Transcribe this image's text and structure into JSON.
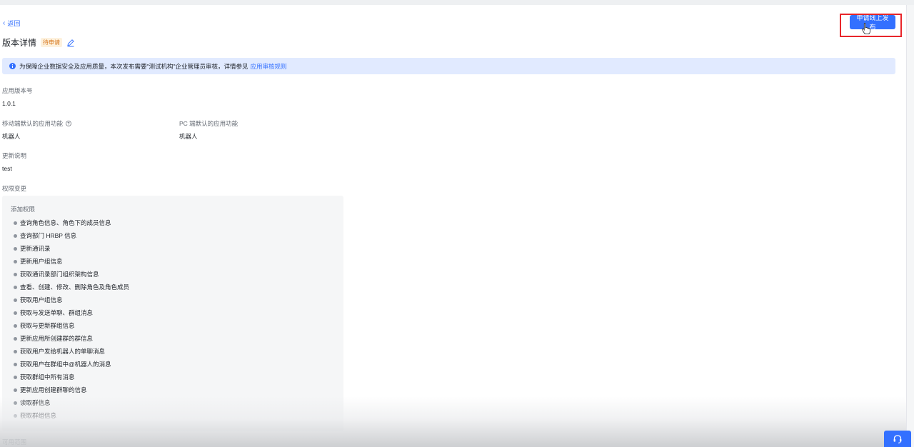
{
  "header": {
    "back_label": "返回",
    "title": "版本详情",
    "status_badge": "待申请",
    "publish_button": "申请线上发布"
  },
  "notice": {
    "text": "为保障企业数据安全及应用质量，本次发布需要\"测试机构\"企业管理员审核，详情参见",
    "link": "应用审核规则"
  },
  "fields": {
    "version_label": "应用版本号",
    "version_value": "1.0.1",
    "mobile_label": "移动端默认的应用功能",
    "mobile_value": "机器人",
    "pc_label": "PC 端默认的应用功能",
    "pc_value": "机器人",
    "update_label": "更新说明",
    "update_value": "test",
    "permission_label": "权限变更",
    "scope_label": "可用范围"
  },
  "permissions": {
    "title": "添加权限",
    "items": [
      "查询角色信息、角色下的成员信息",
      "查询部门 HRBP 信息",
      "更新通讯录",
      "更新用户组信息",
      "获取通讯录部门组织架构信息",
      "查看、创建、修改、删除角色及角色成员",
      "获取用户组信息",
      "获取与发送单聊、群组消息",
      "获取与更新群组信息",
      "更新应用所创建群的群信息",
      "获取用户发给机器人的单聊消息",
      "获取用户在群组中@机器人的消息",
      "获取群组中所有消息",
      "更新应用创建群聊的信息",
      "读取群信息",
      "获取群组信息"
    ]
  },
  "colors": {
    "primary": "#3370ff",
    "badge_text": "#d7751a",
    "badge_bg": "#fdf1dd",
    "notice_bg": "#e1eaff",
    "highlight": "#e8262b"
  }
}
